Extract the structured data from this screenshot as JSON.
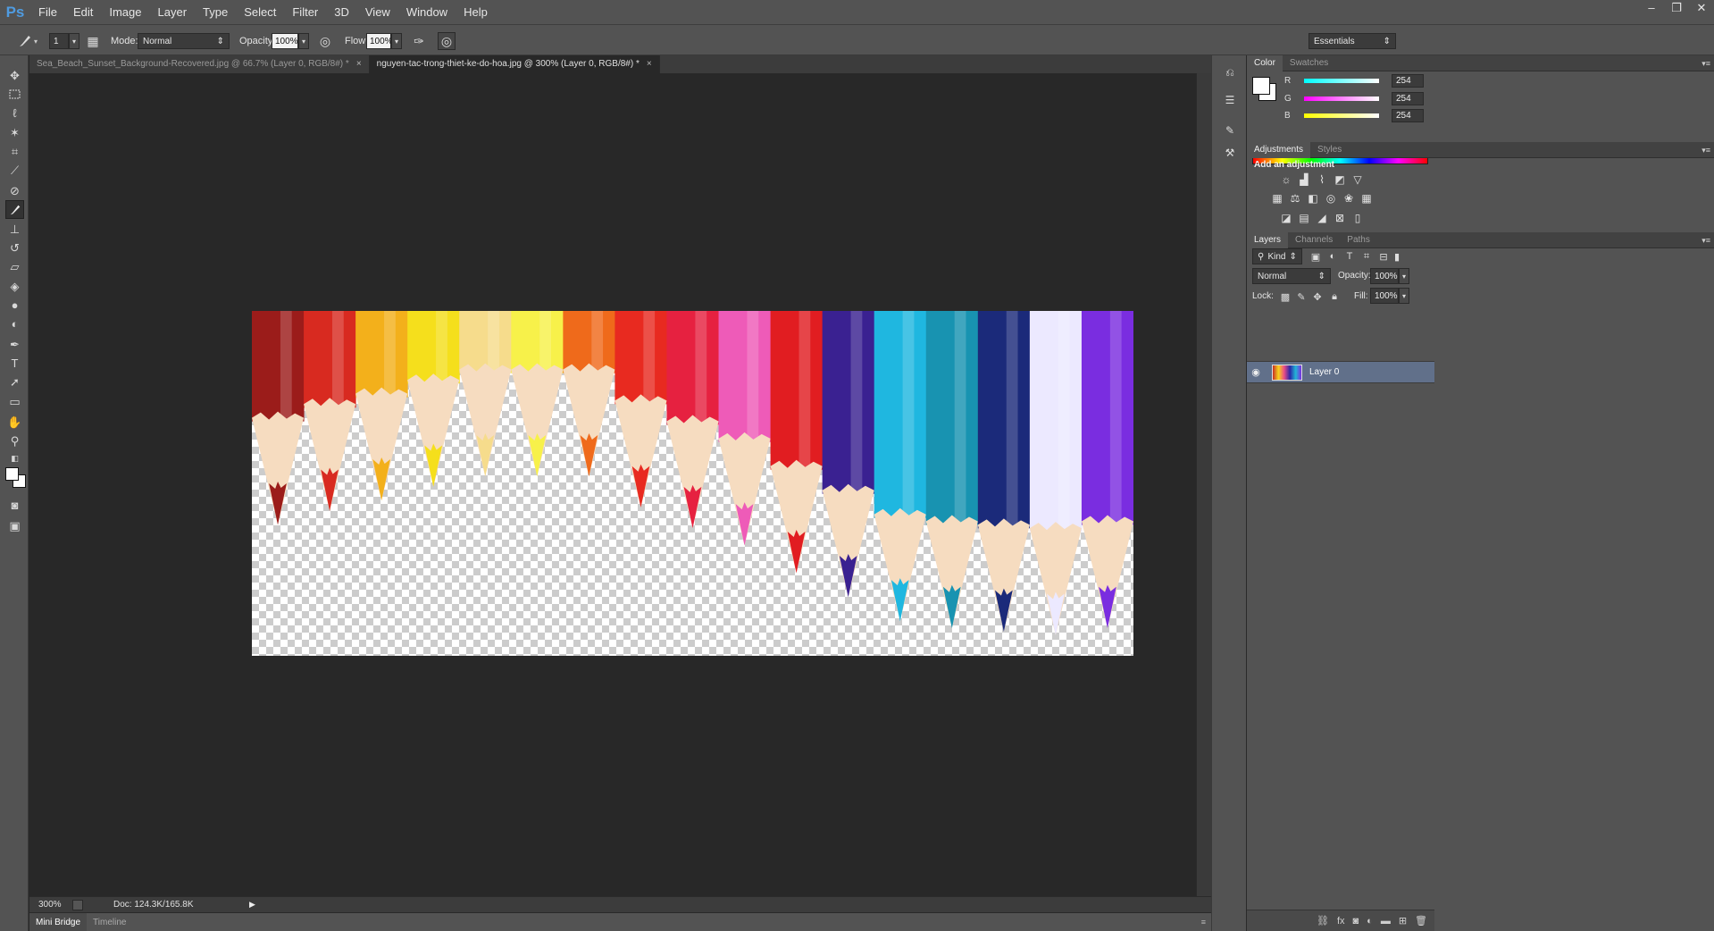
{
  "app": {
    "logo": "Ps"
  },
  "menu": [
    "File",
    "Edit",
    "Image",
    "Layer",
    "Type",
    "Select",
    "Filter",
    "3D",
    "View",
    "Window",
    "Help"
  ],
  "window_controls": {
    "minimize": "–",
    "restore": "❐",
    "close": "✕"
  },
  "options": {
    "brush_size": "1",
    "mode_label": "Mode:",
    "mode_value": "Normal",
    "opacity_label": "Opacity:",
    "opacity_value": "100%",
    "flow_label": "Flow:",
    "flow_value": "100%",
    "workspace": "Essentials"
  },
  "tabs": [
    {
      "label": "Sea_Beach_Sunset_Background-Recovered.jpg @ 66.7% (Layer 0, RGB/8#) *",
      "close": "×"
    },
    {
      "label": "nguyen-tac-trong-thiet-ke-do-hoa.jpg @ 300% (Layer 0, RGB/8#) *",
      "close": "×"
    }
  ],
  "status": {
    "zoom": "300%",
    "doc": "Doc: 124.3K/165.8K"
  },
  "bottom_tabs": [
    "Mini Bridge",
    "Timeline"
  ],
  "color_panel": {
    "tabs": [
      "Color",
      "Swatches"
    ],
    "channels": [
      {
        "label": "R",
        "value": "254",
        "color": "#00ffff"
      },
      {
        "label": "G",
        "value": "254",
        "color": "#ff00ff"
      },
      {
        "label": "B",
        "value": "254",
        "color": "#ffff00"
      }
    ],
    "foreground": "#fefefe",
    "background": "#fefefe"
  },
  "adjustments_panel": {
    "tabs": [
      "Adjustments",
      "Styles"
    ],
    "heading": "Add an adjustment"
  },
  "layers_panel": {
    "tabs": [
      "Layers",
      "Channels",
      "Paths"
    ],
    "kind_filter": "Kind",
    "blend_mode": "Normal",
    "opacity_label": "Opacity:",
    "opacity_value": "100%",
    "lock_label": "Lock:",
    "fill_label": "Fill:",
    "fill_value": "100%",
    "layers": [
      {
        "name": "Layer 0",
        "visible": true,
        "selected": true
      }
    ]
  },
  "pencils": [
    {
      "color": "#9b1c1a",
      "tip": 0.62
    },
    {
      "color": "#d82a20",
      "tip": 0.58
    },
    {
      "color": "#f3b01b",
      "tip": 0.55
    },
    {
      "color": "#f5df1c",
      "tip": 0.51
    },
    {
      "color": "#f6dc8c",
      "tip": 0.48
    },
    {
      "color": "#f7f14a",
      "tip": 0.48
    },
    {
      "color": "#ef6a1b",
      "tip": 0.48
    },
    {
      "color": "#e82a20",
      "tip": 0.57
    },
    {
      "color": "#e62140",
      "tip": 0.63
    },
    {
      "color": "#ee5bb8",
      "tip": 0.68
    },
    {
      "color": "#e11d21",
      "tip": 0.76
    },
    {
      "color": "#3a2191",
      "tip": 0.83
    },
    {
      "color": "#1fb7e0",
      "tip": 0.9
    },
    {
      "color": "#1893b1",
      "tip": 0.92
    },
    {
      "color": "#1b2a7a",
      "tip": 0.93
    },
    {
      "color": "#ece9ff",
      "tip": 0.94
    },
    {
      "color": "#7a2de0",
      "tip": 0.92
    }
  ]
}
